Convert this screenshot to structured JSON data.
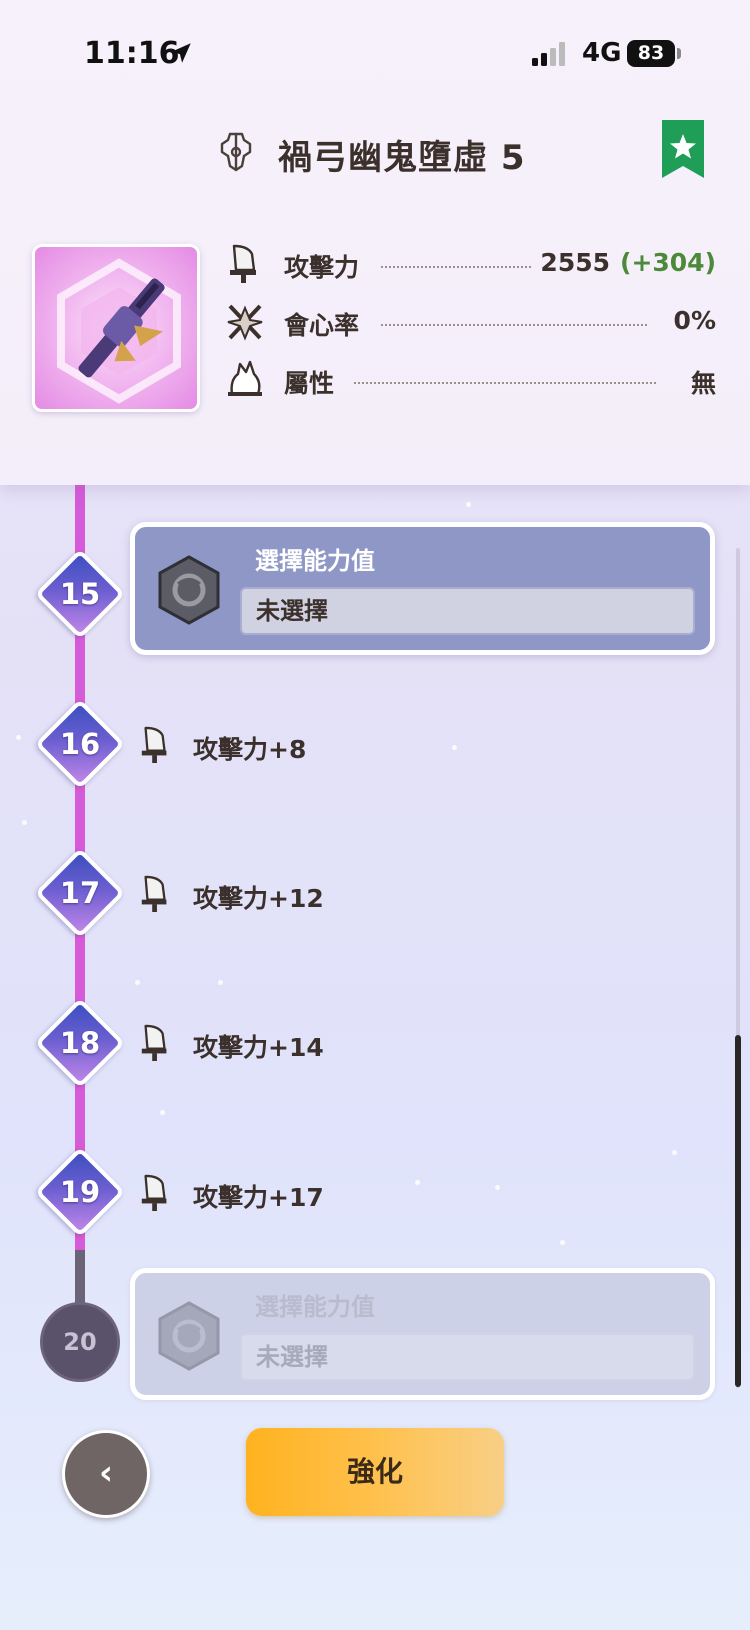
{
  "status_bar": {
    "time": "11:16",
    "network": "4G",
    "battery": "83"
  },
  "header": {
    "title": "禍弓幽鬼墮虛 5"
  },
  "stats": [
    {
      "label": "攻擊力",
      "value": "2555",
      "bonus": "(+304)",
      "icon": "attack-icon"
    },
    {
      "label": "會心率",
      "value": "0%",
      "bonus": "",
      "icon": "affinity-icon"
    },
    {
      "label": "屬性",
      "value": "無",
      "bonus": "",
      "icon": "element-icon"
    }
  ],
  "levels": [
    {
      "level": "15",
      "type": "choice",
      "title": "選擇能力值",
      "value": "未選擇"
    },
    {
      "level": "16",
      "type": "bonus",
      "label": "攻擊力+8"
    },
    {
      "level": "17",
      "type": "bonus",
      "label": "攻擊力+12"
    },
    {
      "level": "18",
      "type": "bonus",
      "label": "攻擊力+14"
    },
    {
      "level": "19",
      "type": "bonus",
      "label": "攻擊力+17"
    },
    {
      "level": "20",
      "type": "choice",
      "title": "選擇能力值",
      "value": "未選擇"
    }
  ],
  "actions": {
    "back": "‹",
    "enhance": "強化"
  },
  "colors": {
    "accent_magenta": "#d65bd8",
    "bonus_green": "#4c8a3a",
    "enhance_orange": "#ffb21f",
    "bookmark_green": "#1f9e57"
  }
}
